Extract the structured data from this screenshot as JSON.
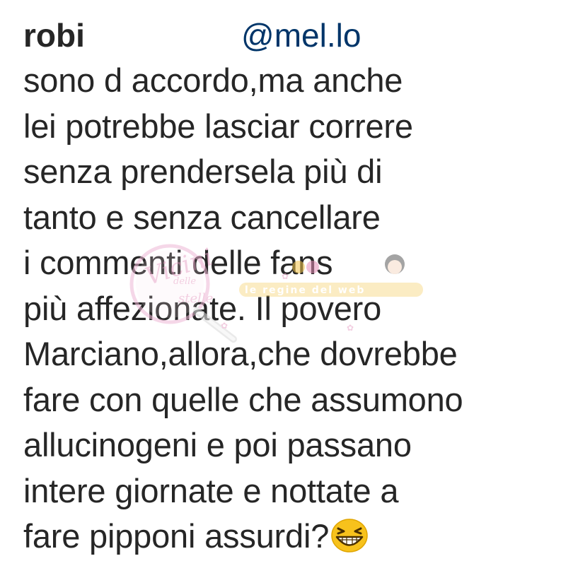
{
  "comment": {
    "username": "robi",
    "mention": "@mel.lo",
    "lines": [
      "sono d accordo,ma anche",
      "lei potrebbe lasciar correre",
      "senza prendersela più di",
      "tanto e senza cancellare",
      "i commenti delle fans",
      "più affezionate. Il povero",
      "Marciano,allora,che dovrebbe",
      "fare con quelle che assumono",
      "allucinogeni e poi passano",
      "intere giornate e nottate a",
      "fare pipponi assurdi?"
    ],
    "trailing_emoji": "grinning-squinting-face-icon"
  },
  "watermark": {
    "text_left": "Vicini delle stelle",
    "text_right": "le regine del web"
  },
  "colors": {
    "text": "#262626",
    "mention": "#003569",
    "watermark_pink": "#e9a7c9",
    "watermark_yellow": "#f3c44a"
  }
}
